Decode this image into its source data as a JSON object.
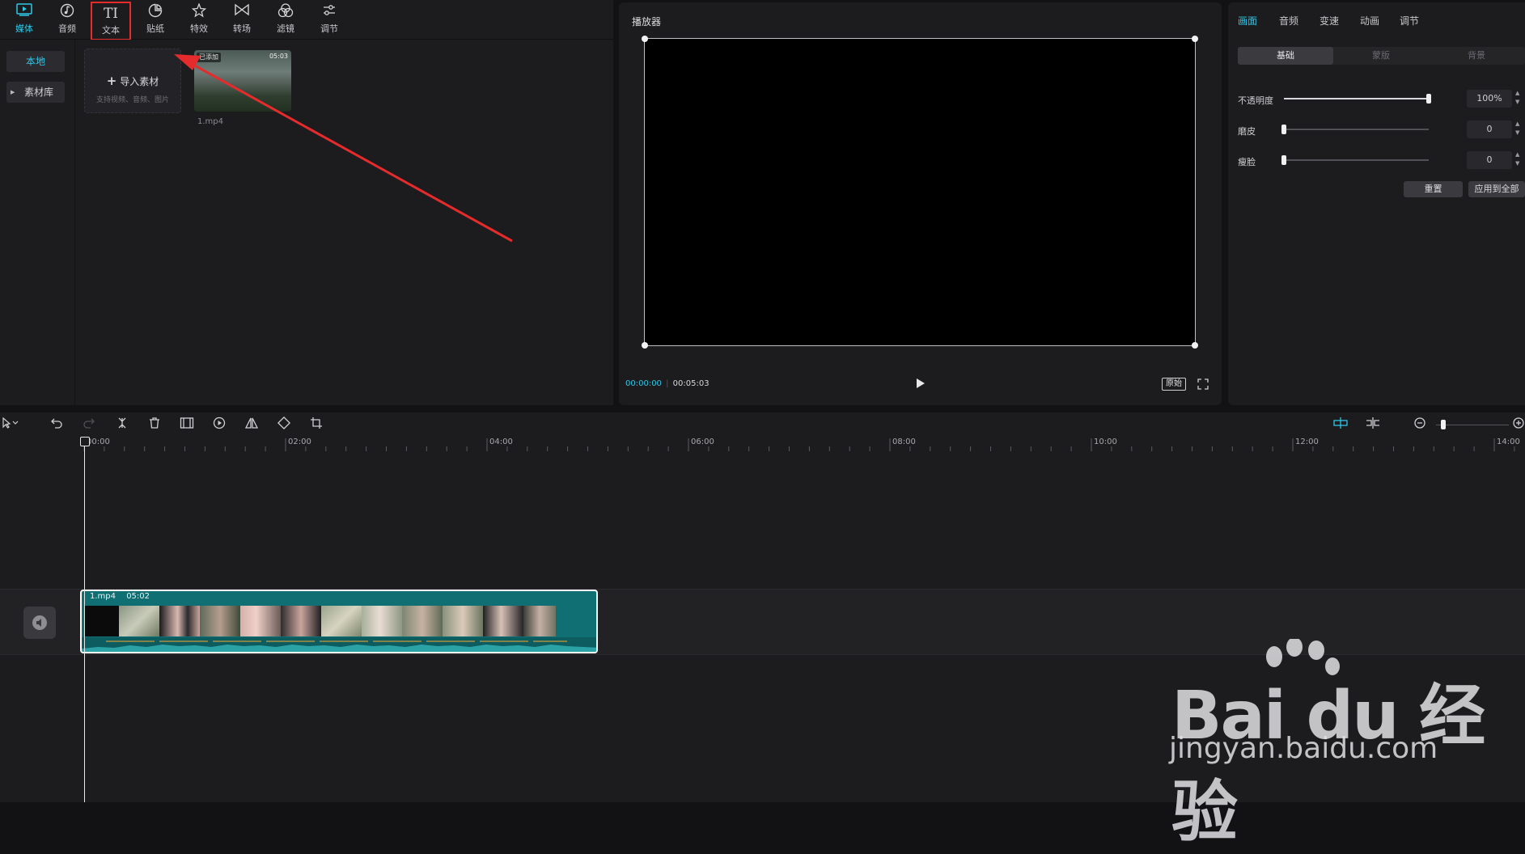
{
  "toolbar": {
    "tools": [
      {
        "label": "媒体",
        "icon": "media-icon"
      },
      {
        "label": "音频",
        "icon": "audio-icon"
      },
      {
        "label": "文本",
        "icon": "text-icon",
        "glyph": "TI"
      },
      {
        "label": "贴纸",
        "icon": "sticker-icon"
      },
      {
        "label": "特效",
        "icon": "effect-icon"
      },
      {
        "label": "转场",
        "icon": "transition-icon"
      },
      {
        "label": "滤镜",
        "icon": "filter-icon"
      },
      {
        "label": "调节",
        "icon": "adjust-icon"
      }
    ]
  },
  "sidebar": {
    "local": "本地",
    "library": "素材库"
  },
  "media": {
    "import_label": "导入素材",
    "import_hint": "支持视频、音频、图片",
    "clip": {
      "badge": "已添加",
      "duration": "05:03",
      "filename": "1.mp4"
    }
  },
  "player": {
    "title": "播放器",
    "current_time": "00:00:00",
    "total_time": "00:05:03",
    "ratio_label": "原始"
  },
  "inspector": {
    "tabs": [
      "画面",
      "音频",
      "变速",
      "动画",
      "调节"
    ],
    "subtabs": [
      "基础",
      "蒙版",
      "背景"
    ],
    "rows": [
      {
        "label": "不透明度",
        "value": "100%",
        "level": 1.0
      },
      {
        "label": "磨皮",
        "value": "0",
        "level": 0.0
      },
      {
        "label": "瘦脸",
        "value": "0",
        "level": 0.0
      }
    ],
    "reset_label": "重置",
    "apply_all_label": "应用到全部"
  },
  "timeline": {
    "ticks": [
      "00:00",
      "02:00",
      "04:00",
      "06:00",
      "08:00",
      "10:00",
      "12:00",
      "14:00"
    ],
    "clip": {
      "name": "1.mp4",
      "duration": "05:02"
    },
    "zoom_level": 0.1
  },
  "watermark": {
    "logo": "Bai du 经验",
    "url": "jingyan.baidu.com"
  },
  "colors": {
    "accent": "#2ec7e6",
    "annotation": "#e52b2b",
    "clip": "#0f6f73"
  }
}
